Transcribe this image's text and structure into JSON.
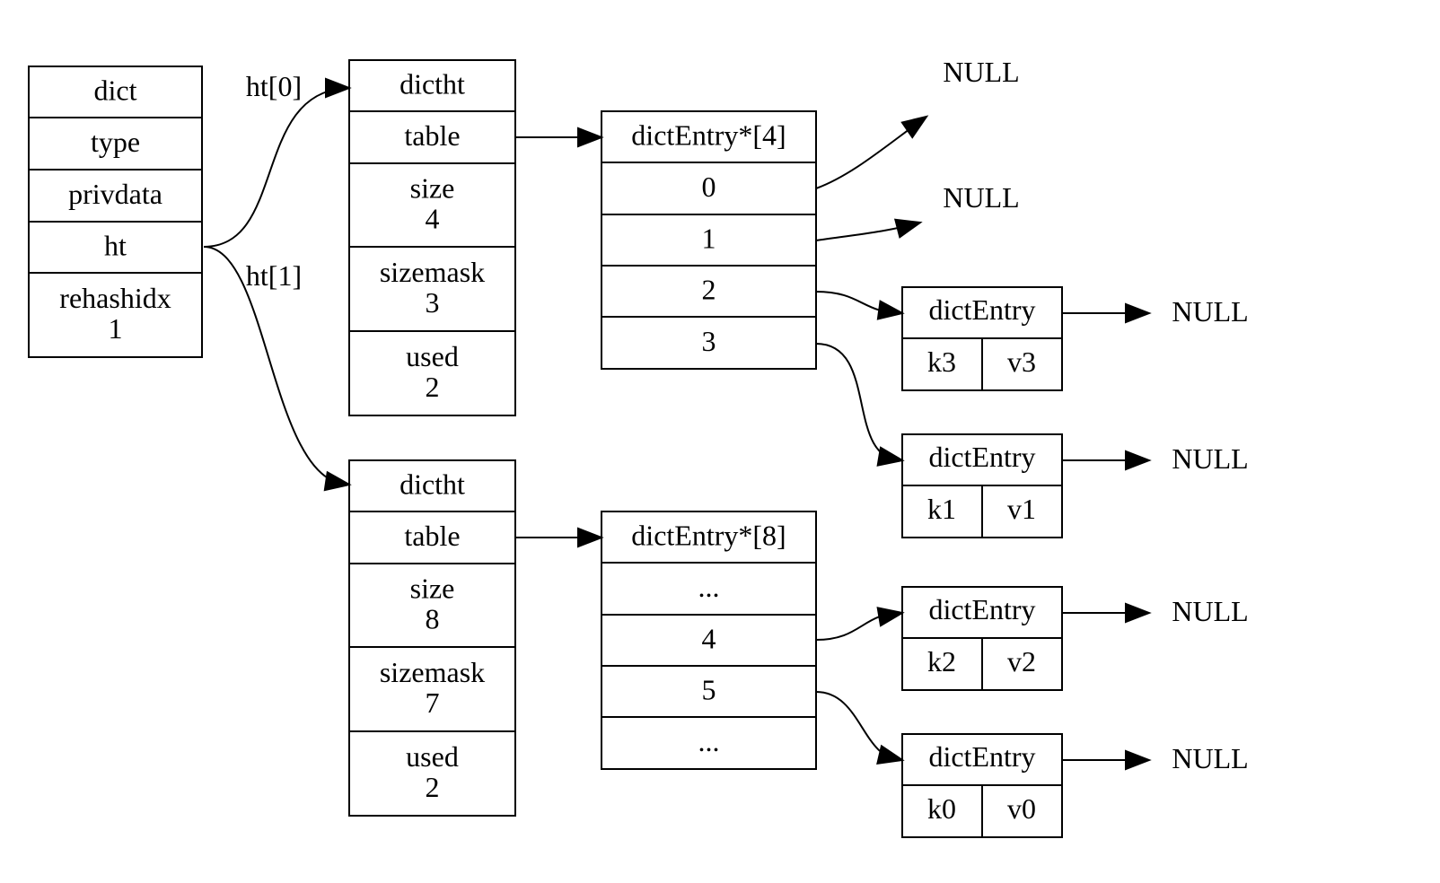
{
  "dict": {
    "rows": [
      "dict",
      "type",
      "privdata",
      "ht",
      "rehashidx\n1"
    ]
  },
  "ht0_label": "ht[0]",
  "ht1_label": "ht[1]",
  "dictht0": {
    "rows": [
      "dictht",
      "table",
      "size\n4",
      "sizemask\n3",
      "used\n2"
    ]
  },
  "dictht1": {
    "rows": [
      "dictht",
      "table",
      "size\n8",
      "sizemask\n7",
      "used\n2"
    ]
  },
  "table0": {
    "rows": [
      "dictEntry*[4]",
      "0",
      "1",
      "2",
      "3"
    ]
  },
  "table1": {
    "rows": [
      "dictEntry*[8]",
      "...",
      "4",
      "5",
      "..."
    ]
  },
  "entries": [
    {
      "title": "dictEntry",
      "key": "k3",
      "value": "v3",
      "next": "NULL"
    },
    {
      "title": "dictEntry",
      "key": "k1",
      "value": "v1",
      "next": "NULL"
    },
    {
      "title": "dictEntry",
      "key": "k2",
      "value": "v2",
      "next": "NULL"
    },
    {
      "title": "dictEntry",
      "key": "k0",
      "value": "v0",
      "next": "NULL"
    }
  ],
  "null_bucket0": "NULL",
  "null_bucket1": "NULL"
}
